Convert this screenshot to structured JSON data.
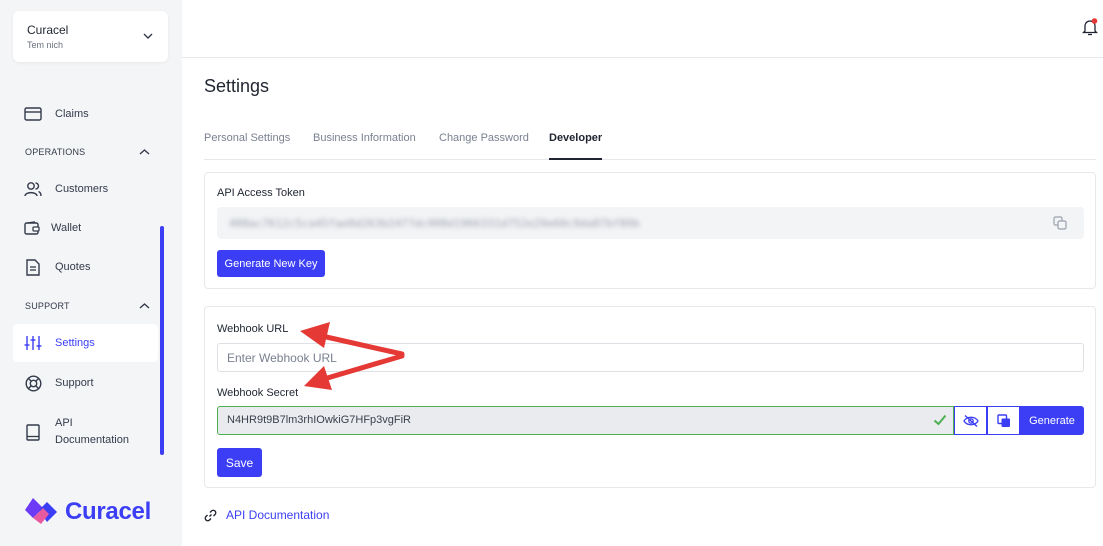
{
  "org": {
    "name": "Curacel",
    "team": "Tem nich"
  },
  "sidebar": {
    "items": [
      {
        "label": "Claims",
        "icon": "card-icon"
      },
      {
        "label": "Customers",
        "icon": "users-icon"
      },
      {
        "label": "Wallet",
        "icon": "wallet-icon"
      },
      {
        "label": "Quotes",
        "icon": "document-icon"
      },
      {
        "label": "Settings",
        "icon": "sliders-icon",
        "active": true
      },
      {
        "label": "Support",
        "icon": "lifebuoy-icon"
      },
      {
        "label": "API\nDocumentation",
        "icon": "book-icon"
      }
    ],
    "sections": {
      "operations": "OPERATIONS",
      "support": "SUPPORT"
    },
    "logo_text": "Curacel"
  },
  "page": {
    "title": "Settings"
  },
  "tabs": [
    {
      "label": "Personal Settings"
    },
    {
      "label": "Business Information"
    },
    {
      "label": "Change Password"
    },
    {
      "label": "Developer",
      "active": true
    }
  ],
  "api_token": {
    "label": "API Access Token",
    "value": "408ac7612c5ca45fae0d263b2477dc908d1966331d752e29e60c9da87bf89b",
    "button": "Generate New Key"
  },
  "webhook": {
    "url_label": "Webhook URL",
    "url_placeholder": "Enter Webhook URL",
    "secret_label": "Webhook Secret",
    "secret_value": "N4HR9t9B7lm3rhIOwkiG7HFp3vgFiR",
    "generate_label": "Generate",
    "save_label": "Save"
  },
  "footer_link": "API Documentation",
  "colors": {
    "accent": "#3b3ef5",
    "annotation": "#e53935",
    "success": "#4caf50"
  }
}
